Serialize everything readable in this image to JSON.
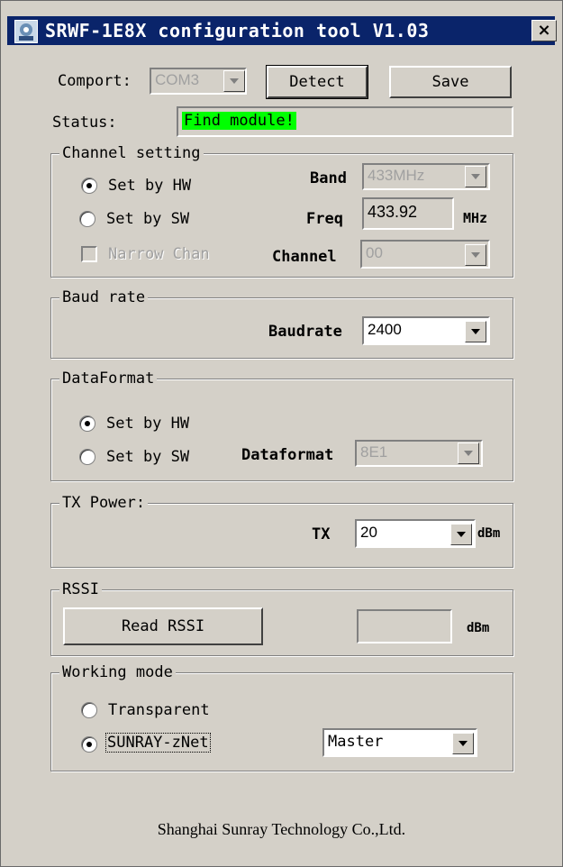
{
  "window": {
    "title": "SRWF-1E8X configuration tool V1.03",
    "close_symbol": "×",
    "icon": "app-icon"
  },
  "comport": {
    "label": "Comport:",
    "value": "COM3",
    "detect_label": "Detect",
    "save_label": "Save"
  },
  "status": {
    "label": "Status:",
    "value": "Find module!",
    "highlight_color": "#00ff00"
  },
  "channel_setting": {
    "title": "Channel setting",
    "set_by_hw": "Set by HW",
    "set_by_sw": "Set by SW",
    "selected": "Set by HW",
    "narrow_chan": "Narrow Chan",
    "narrow_chan_checked": false,
    "band_label": "Band",
    "band_value": "433MHz",
    "freq_label": "Freq",
    "freq_value": "433.92",
    "freq_unit": "MHz",
    "channel_label": "Channel",
    "channel_value": "00"
  },
  "baud_rate": {
    "title": "Baud rate",
    "label": "Baudrate",
    "value": "2400"
  },
  "data_format": {
    "title": "DataFormat",
    "set_by_hw": "Set by HW",
    "set_by_sw": "Set by SW",
    "selected": "Set by HW",
    "label": "Dataformat",
    "value": "8E1"
  },
  "tx_power": {
    "title": "TX Power:",
    "label": "TX",
    "value": "20",
    "unit": "dBm"
  },
  "rssi": {
    "title": "RSSI",
    "read_label": "Read RSSI",
    "value": "",
    "unit": "dBm"
  },
  "working_mode": {
    "title": "Working mode",
    "transparent": "Transparent",
    "sunray_znet": "SUNRAY-zNet",
    "selected": "SUNRAY-zNet",
    "role_value": "Master"
  },
  "footer": {
    "company": "Shanghai Sunray Technology Co.,Ltd."
  }
}
